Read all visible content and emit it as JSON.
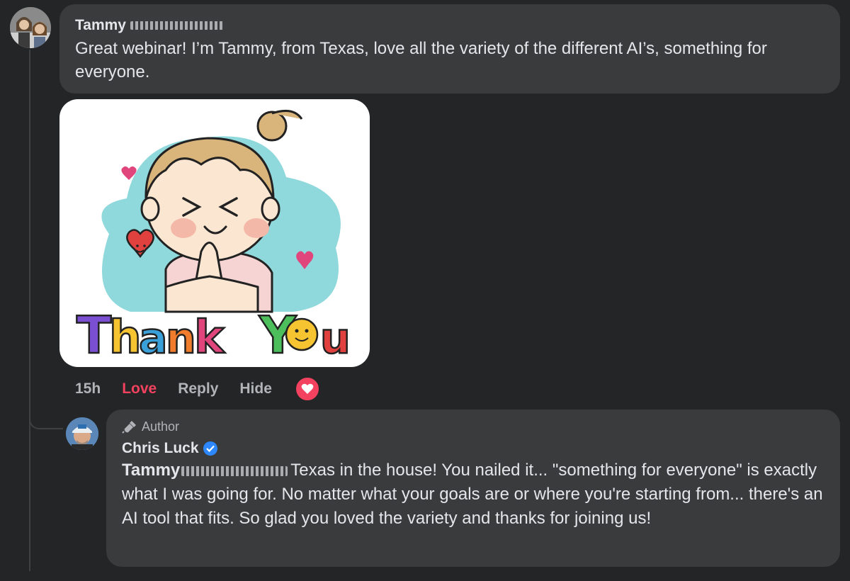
{
  "comment": {
    "author": "Tammy",
    "text": "Great webinar! I’m Tammy, from Texas, love all the variety of the different AI’s, something for everyone.",
    "sticker": {
      "text": "Thank You",
      "colors": [
        "#7b4fd1",
        "#f5c430",
        "#3aa0d9",
        "#f07c2c",
        "#e0457b",
        "#4cbf5c"
      ]
    },
    "actions": {
      "time": "15h",
      "love": "Love",
      "reply": "Reply",
      "hide": "Hide"
    },
    "reaction_icon": "heart-icon"
  },
  "reply": {
    "badge": "Author",
    "badge_icon": "microphone-icon",
    "author": "Chris Luck",
    "verified_icon": "verified-badge-icon",
    "mention": "Tammy",
    "text": "Texas in the house! You nailed it... \"something for everyone\" is exactly what I was going for. No matter what your goals are or where you're starting from... there's an AI tool that fits. So glad you loved the variety and thanks for joining us!"
  },
  "colors": {
    "background": "#242526",
    "bubble": "#3a3b3c",
    "love": "#f3425f",
    "verified": "#2d88ff"
  }
}
